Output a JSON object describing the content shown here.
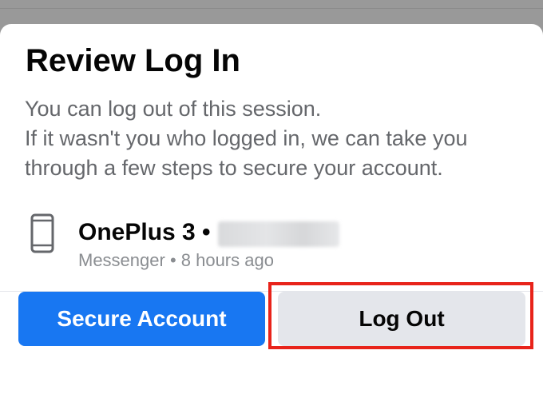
{
  "dialog": {
    "title": "Review Log In",
    "description_lines": [
      "You can log out of this session.",
      "If it wasn't you who logged in, we can take you",
      "through a few steps to secure your account."
    ]
  },
  "session": {
    "device_icon": "phone-icon",
    "device_name": "OnePlus 3 •",
    "meta": "Messenger • 8 hours ago"
  },
  "actions": {
    "secure_label": "Secure Account",
    "logout_label": "Log Out"
  },
  "colors": {
    "primary": "#1877f2",
    "secondary_button": "#e4e6eb",
    "highlight": "#e8231a"
  }
}
